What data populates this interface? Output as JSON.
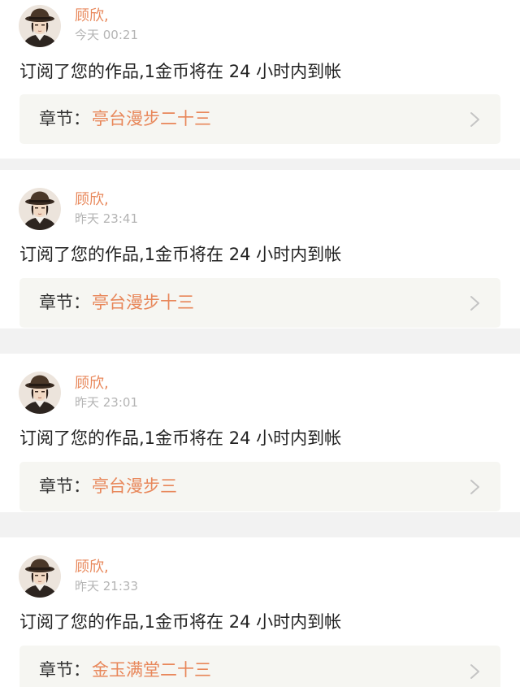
{
  "messages": [
    {
      "author": "顾欣,",
      "time": "今天 00:21",
      "text": "订阅了您的作品,1金币将在 24 小时内到帐",
      "chapter_prefix": "章节：",
      "chapter_title": "亭台漫步二十三"
    },
    {
      "author": "顾欣,",
      "time": "昨天 23:41",
      "text": "订阅了您的作品,1金币将在 24 小时内到帐",
      "chapter_prefix": "章节：",
      "chapter_title": "亭台漫步十三"
    },
    {
      "author": "顾欣,",
      "time": "昨天 23:01",
      "text": "订阅了您的作品,1金币将在 24 小时内到帐",
      "chapter_prefix": "章节：",
      "chapter_title": "亭台漫步三"
    },
    {
      "author": "顾欣,",
      "time": "昨天 21:33",
      "text": "订阅了您的作品,1金币将在 24 小时内到帐",
      "chapter_prefix": "章节：",
      "chapter_title": "金玉满堂二十三"
    }
  ],
  "icons": {
    "avatar": "user-avatar-icon",
    "chevron": "chevron-right-icon"
  },
  "colors": {
    "accent": "#e8875a",
    "separator": "#f2f2f2",
    "chapter_box": "#f6f6f2",
    "text": "#222222",
    "muted": "#b4b4b4"
  }
}
